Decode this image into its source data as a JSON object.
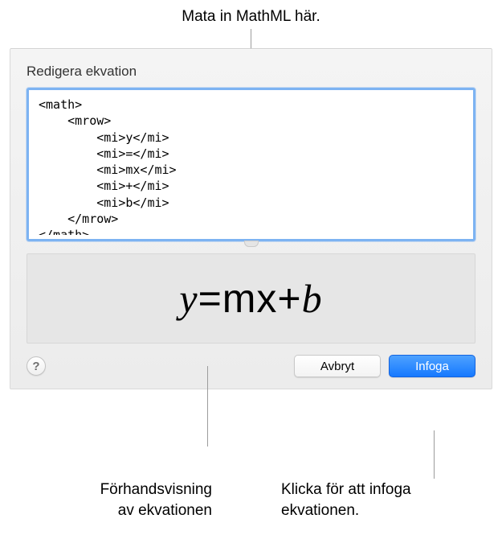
{
  "callouts": {
    "top": "Mata in MathML här.",
    "preview_line1": "Förhandsvisning",
    "preview_line2": "av ekvationen",
    "insert_line1": "Klicka för att infoga",
    "insert_line2": "ekvationen."
  },
  "dialog": {
    "title": "Redigera ekvation",
    "editor_content": "<math>\n    <mrow>\n        <mi>y</mi>\n        <mi>=</mi>\n        <mi>mx</mi>\n        <mi>+</mi>\n        <mi>b</mi>\n    </mrow>\n</math>",
    "buttons": {
      "help": "?",
      "cancel": "Avbryt",
      "insert": "Infoga"
    }
  },
  "chart_data": {
    "type": "table",
    "note": "Rendered equation preview",
    "components": [
      {
        "token": "y",
        "style": "italic"
      },
      {
        "token": "=",
        "style": "roman"
      },
      {
        "token": "mx",
        "style": "roman"
      },
      {
        "token": "+",
        "style": "roman"
      },
      {
        "token": "b",
        "style": "italic"
      }
    ],
    "rendered": "y=mx+b"
  }
}
